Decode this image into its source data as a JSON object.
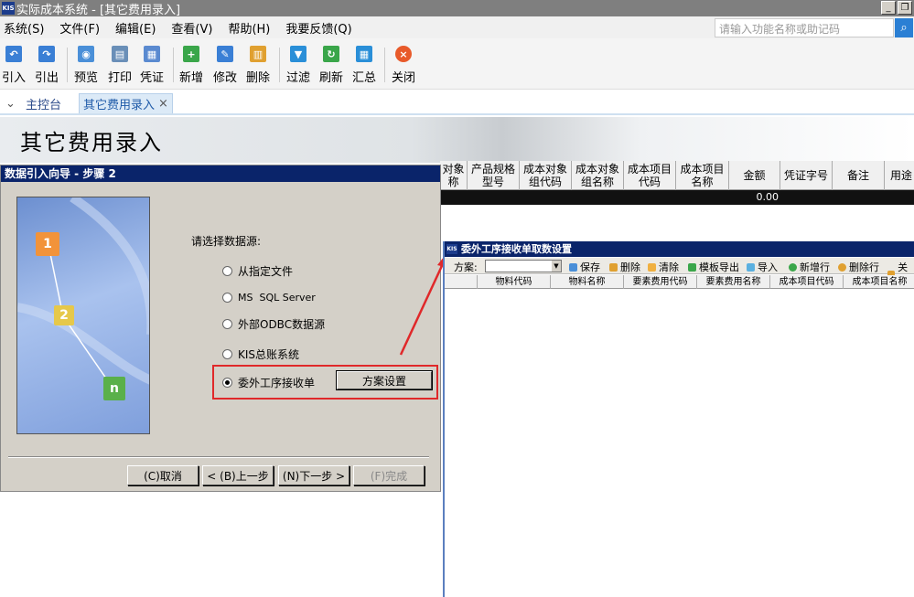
{
  "window": {
    "title": "实际成本系统 - [其它费用录入]",
    "logo": "KIS"
  },
  "menu": [
    "系统(S)",
    "文件(F)",
    "编辑(E)",
    "查看(V)",
    "帮助(H)",
    "我要反馈(Q)"
  ],
  "search": {
    "placeholder": "请输入功能名称或助记码"
  },
  "toolbar": [
    {
      "label": "引入",
      "icon": "import-icon",
      "color": "#3a7fd5"
    },
    {
      "label": "引出",
      "icon": "export-icon",
      "color": "#3a7fd5"
    },
    {
      "label": "预览",
      "icon": "preview-icon",
      "color": "#4a8fd8"
    },
    {
      "label": "打印",
      "icon": "print-icon",
      "color": "#6a8fb8"
    },
    {
      "label": "凭证",
      "icon": "voucher-icon",
      "color": "#5a8ad0"
    },
    {
      "label": "新增",
      "icon": "add-icon",
      "color": "#3aa64a"
    },
    {
      "label": "修改",
      "icon": "edit-icon",
      "color": "#3a7fd5"
    },
    {
      "label": "删除",
      "icon": "delete-icon",
      "color": "#e0a030"
    },
    {
      "label": "过滤",
      "icon": "filter-icon",
      "color": "#2a8fd8"
    },
    {
      "label": "刷新",
      "icon": "refresh-icon",
      "color": "#3aa64a"
    },
    {
      "label": "汇总",
      "icon": "summary-icon",
      "color": "#2a8fd8"
    },
    {
      "label": "关闭",
      "icon": "close-icon",
      "color": "#e85a2a"
    }
  ],
  "tabs": [
    {
      "label": "主控台"
    },
    {
      "label": "其它费用录入"
    }
  ],
  "tab_close": "×",
  "page": {
    "banner_title": "其它费用录入"
  },
  "grid": {
    "headers": [
      "对象\n称",
      "产品规格\n型号",
      "成本对象\n组代码",
      "成本对象\n组名称",
      "成本项目\n代码",
      "成本项目\n名称",
      "金额",
      "凭证字号",
      "备注",
      "用途"
    ],
    "amount": "0.00"
  },
  "wizard": {
    "title": "数据引入向导 - 步骤 2",
    "prompt": "请选择数据源:",
    "options": [
      {
        "label": "从指定文件",
        "selected": false
      },
      {
        "label": "MS  SQL Server",
        "selected": false
      },
      {
        "label": "外部ODBC数据源",
        "selected": false
      },
      {
        "label": "KIS总账系统",
        "selected": false
      },
      {
        "label": "委外工序接收单",
        "selected": true
      }
    ],
    "scheme_button": "方案设置",
    "cubes": [
      "1",
      "2",
      "n"
    ],
    "buttons": {
      "cancel": "(C)取消",
      "prev": "< (B)上一步",
      "next": "(N)下一步 >",
      "finish": "(F)完成"
    }
  },
  "recv_dialog": {
    "title": "委外工序接收单取数设置",
    "logo": "KIS",
    "scheme_label": "方案:",
    "toolbar": [
      "保存",
      "删除",
      "清除",
      "模板导出",
      "导入",
      "新增行",
      "删除行",
      "关闭"
    ],
    "headers": [
      "物料代码",
      "物料名称",
      "要素费用代码",
      "要素费用名称",
      "成本项目代码",
      "成本项目名称"
    ]
  }
}
